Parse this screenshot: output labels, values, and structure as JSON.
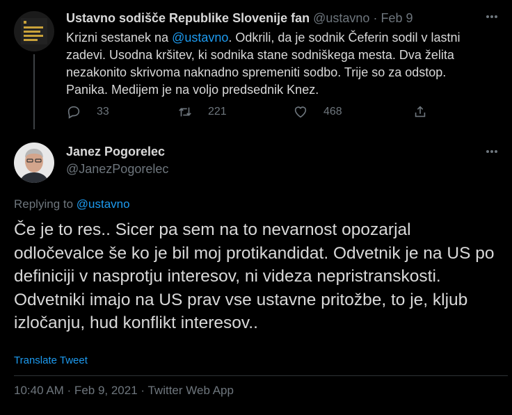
{
  "parent_tweet": {
    "author_name": "Ustavno sodišče Republike Slovenije fan",
    "handle": "@ustavno",
    "separator": " · ",
    "date": "Feb 9",
    "text_prefix": "Krizni sestanek na ",
    "text_mention": "@ustavno",
    "text_suffix": ". Odkrili, da je sodnik Čeferin sodil v lastni zadevi. Usodna kršitev, ki sodnika stane sodniškega mesta. Dva želita nezakonito skrivoma naknadno spremeniti sodbo. Trije so za odstop. Panika. Medijem je na voljo predsednik Knez.",
    "replies": "33",
    "retweets": "221",
    "likes": "468"
  },
  "reply_tweet": {
    "author_name": "Janez Pogorelec",
    "handle": "@JanezPogorelec",
    "replying_label": "Replying to ",
    "replying_to": "@ustavno",
    "text": "Če je to res.. Sicer pa sem na to nevarnost opozarjal odločevalce še ko je bil moj protikandidat. Odvetnik je na US po definiciji v nasprotju interesov, ni videza nepristranskosti.  Odvetniki imajo na US prav vse ustavne pritožbe, to je, kljub izločanju, hud konflikt interesov..",
    "translate_label": "Translate Tweet",
    "timestamp": "10:40 AM · Feb 9, 2021 · Twitter Web App"
  },
  "colors": {
    "background": "#000000",
    "text": "#d9d9d9",
    "muted": "#6e767d",
    "accent": "#1d9bf0"
  },
  "icons": [
    "reply-icon",
    "retweet-icon",
    "like-icon",
    "share-icon",
    "more-icon"
  ]
}
